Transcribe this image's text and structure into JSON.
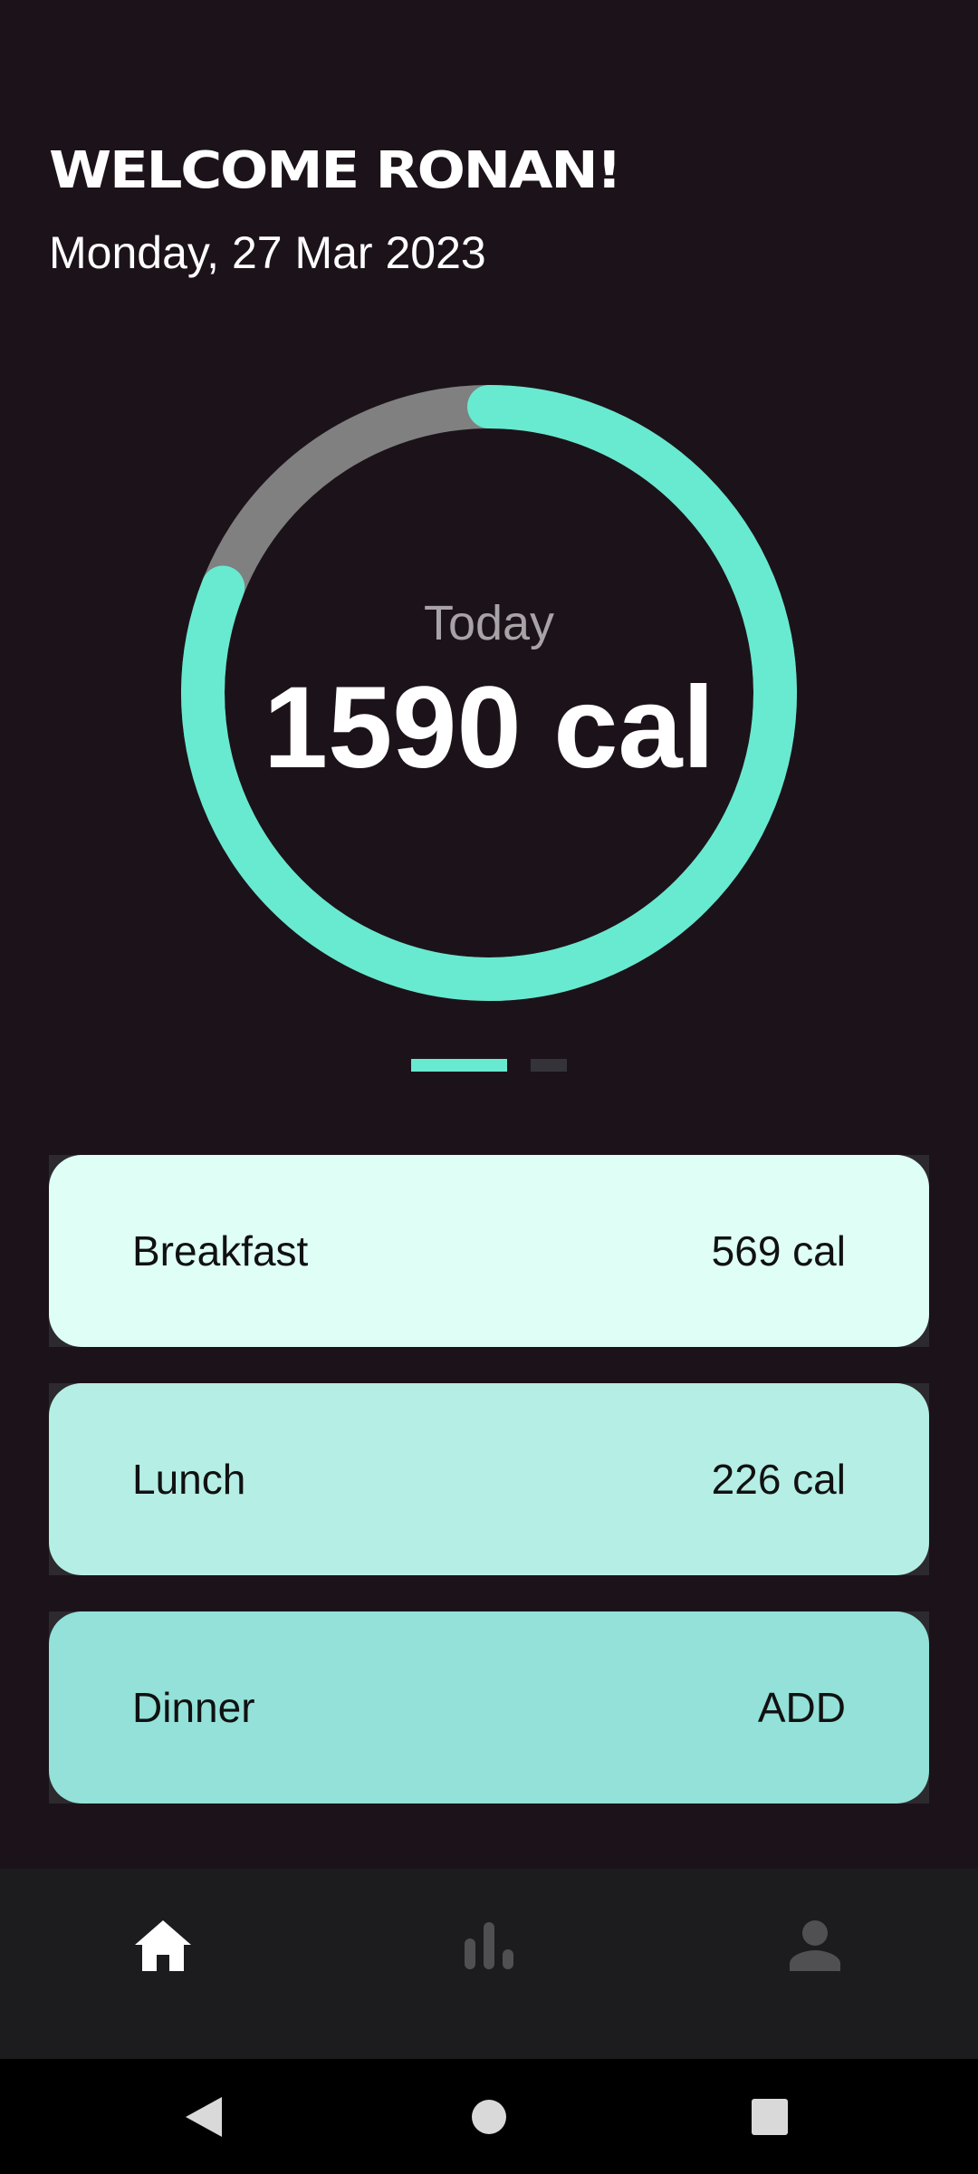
{
  "header": {
    "title": "WELCOME RONAN!",
    "date": "Monday, 27 Mar 2023"
  },
  "summary": {
    "label": "Today",
    "value": "1590 cal",
    "progress_fraction": 0.81
  },
  "pager": {
    "pages": 2,
    "active_index": 0
  },
  "meals": [
    {
      "name": "Breakfast",
      "value": "569 cal",
      "color": "#DEFEF6"
    },
    {
      "name": "Lunch",
      "value": "226 cal",
      "color": "#B5EEE5"
    },
    {
      "name": "Dinner",
      "value": "ADD",
      "color": "#93E1D8"
    }
  ],
  "bottom_nav": {
    "items": [
      {
        "icon": "home-icon",
        "active": true
      },
      {
        "icon": "bar-chart-icon",
        "active": false
      },
      {
        "icon": "person-icon",
        "active": false
      }
    ]
  },
  "system_nav": {
    "items": [
      "back-icon",
      "home-circle-icon",
      "recents-icon"
    ]
  },
  "colors": {
    "background": "#1C131A",
    "accent": "#68EAD0",
    "ring_track": "#808080",
    "nav_background": "#1C1C1E"
  }
}
